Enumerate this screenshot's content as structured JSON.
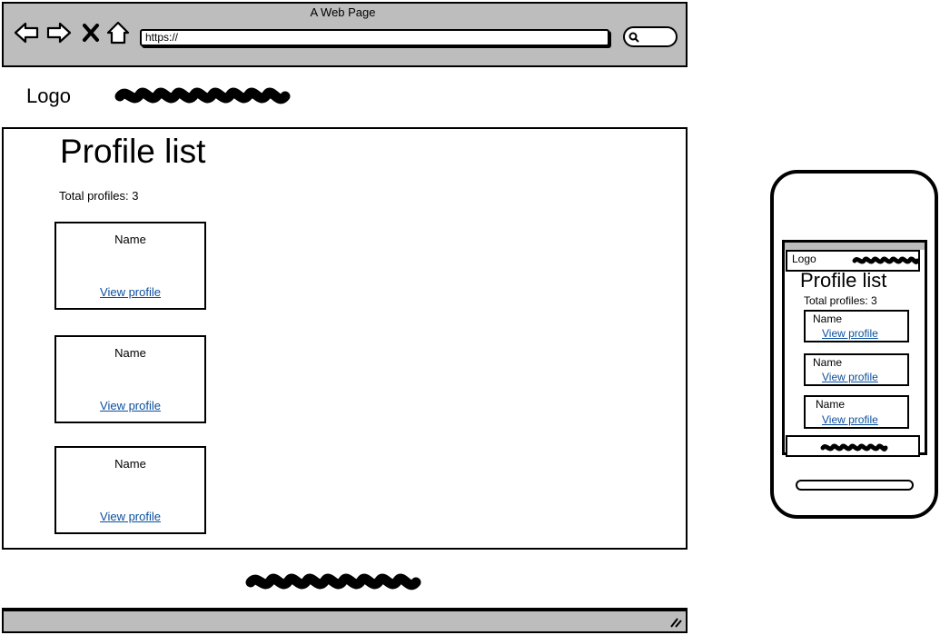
{
  "browser": {
    "window_title": "A Web Page",
    "url": "https://",
    "icons": [
      "back-arrow-icon",
      "forward-arrow-icon",
      "close-x-icon",
      "home-icon",
      "search-icon"
    ]
  },
  "header": {
    "logo": "Logo"
  },
  "main": {
    "title": "Profile list",
    "total_label": "Total profiles: 3",
    "cards": [
      {
        "name": "Name",
        "link": "View profile"
      },
      {
        "name": "Name",
        "link": "View profile"
      },
      {
        "name": "Name",
        "link": "View profile"
      }
    ]
  },
  "mobile": {
    "logo": "Logo",
    "title": "Profile list",
    "total_label": "Total profiles: 3",
    "cards": [
      {
        "name": "Name",
        "link": "View profile"
      },
      {
        "name": "Name",
        "link": "View profile"
      },
      {
        "name": "Name",
        "link": "View profile"
      }
    ]
  }
}
